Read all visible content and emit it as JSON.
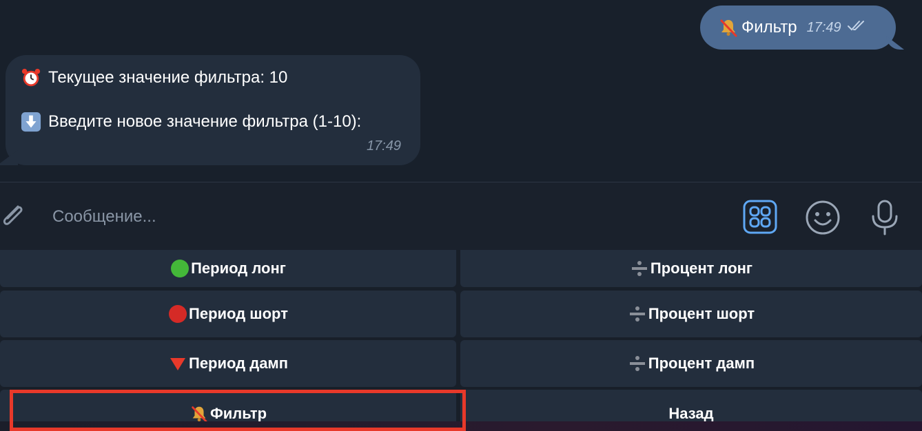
{
  "outgoing": {
    "text": "Фильтр",
    "time": "17:49",
    "icon": "muted-bell-icon"
  },
  "incoming": {
    "line1": "Текущее значение фильтра: 10",
    "line1_icon": "alarm-clock-icon",
    "line2": "Введите новое значение фильтра (1-10):",
    "line2_icon": "down-arrow-icon",
    "time": "17:49"
  },
  "input": {
    "placeholder": "Сообщение..."
  },
  "keyboard": {
    "rows": [
      {
        "left": {
          "label": "Период лонг",
          "icon": "green-circle-icon"
        },
        "right": {
          "label": "Процент лонг",
          "icon": "divide-icon"
        }
      },
      {
        "left": {
          "label": "Период шорт",
          "icon": "red-circle-icon"
        },
        "right": {
          "label": "Процент шорт",
          "icon": "divide-icon"
        }
      },
      {
        "left": {
          "label": "Период дамп",
          "icon": "red-triangle-down-icon"
        },
        "right": {
          "label": "Процент дамп",
          "icon": "divide-icon"
        }
      },
      {
        "left": {
          "label": "Фильтр",
          "icon": "muted-bell-icon"
        },
        "right": {
          "label": "Назад"
        }
      }
    ]
  },
  "colors": {
    "accent": "#5fa8f5",
    "highlight": "#e8392a",
    "bubble_out": "#4d6b93",
    "bubble_in": "#232e3d"
  }
}
